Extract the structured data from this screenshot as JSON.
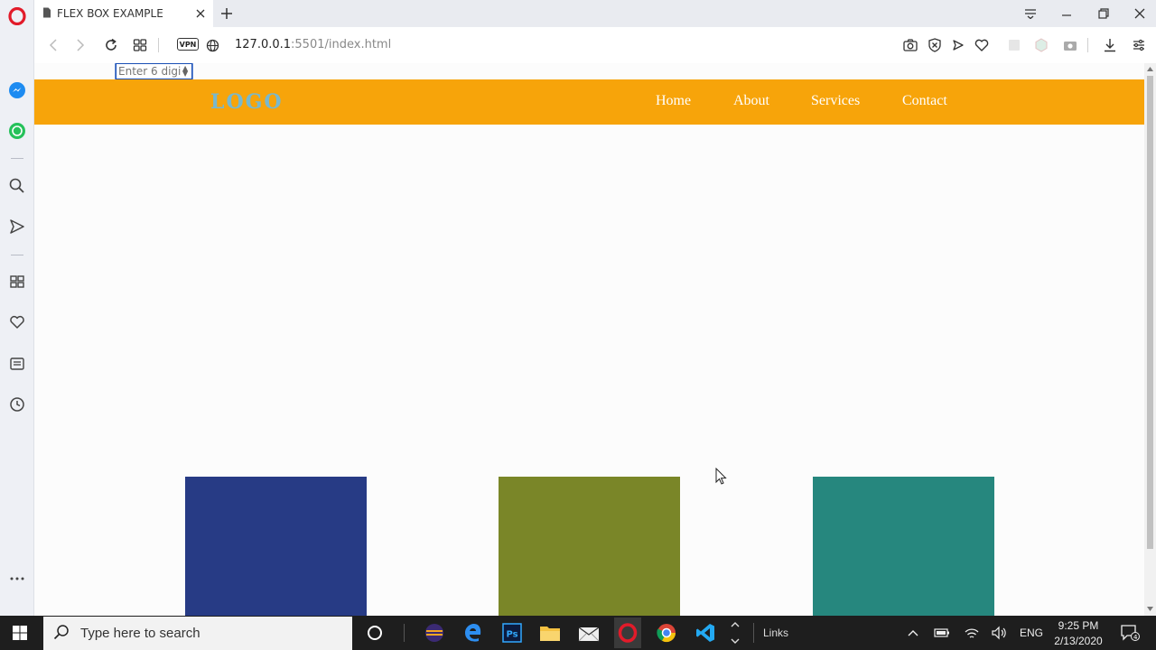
{
  "browser": {
    "tab_title": "FLEX BOX EXAMPLE",
    "url_host": "127.0.0.1",
    "url_path": ":5501/index.html",
    "vpn_label": "VPN"
  },
  "page": {
    "input_placeholder": "Enter 6 digi",
    "logo": "LOGO",
    "nav": [
      "Home",
      "About",
      "Services",
      "Contact"
    ],
    "colors": {
      "navbar": "#f7a40a",
      "logo": "#79b8cc",
      "box1": "#273b85",
      "box2": "#7a8628",
      "box3": "#26877e"
    }
  },
  "taskbar": {
    "search_placeholder": "Type here to search",
    "links_label": "Links",
    "language": "ENG",
    "time": "9:25 PM",
    "date": "2/13/2020",
    "notification_count": "4"
  }
}
